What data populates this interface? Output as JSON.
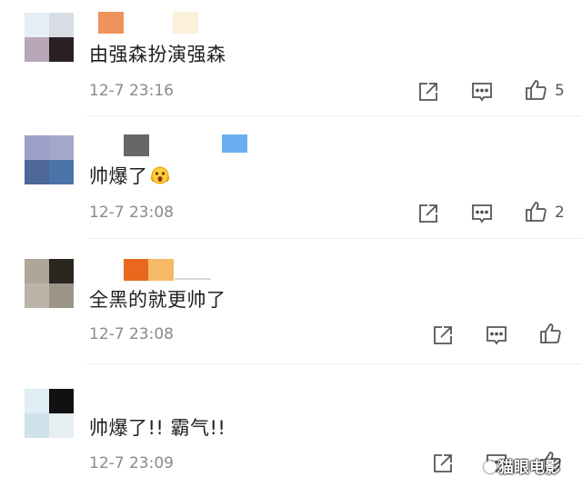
{
  "comments": [
    {
      "avatar_colors": [
        "#e4eef5",
        "#d8dde3",
        "#b9a6b8",
        "#2a1f24"
      ],
      "name_colors": [
        "#ef935a",
        "#fbf1d9"
      ],
      "text": "由强森扮演强森",
      "time": "12-7 23:16",
      "likes": "5"
    },
    {
      "avatar_colors": [
        "#9aa0c8",
        "#a4a7cb",
        "#4d6797",
        "#4d74a8"
      ],
      "name_colors": [
        "#676767",
        "#6ab0f0"
      ],
      "text": "帅爆了",
      "emoji": "surprised-face-emoji",
      "time": "12-7 23:08",
      "likes": "2"
    },
    {
      "avatar_colors": [
        "#aea696",
        "#2a251e",
        "#bab5a8",
        "#9c9689"
      ],
      "name_colors": [
        "#e8681d",
        "#f6b967"
      ],
      "text": "全黑的就更帅了",
      "time": "12-7 23:08",
      "likes": ""
    },
    {
      "avatar_colors": [
        "#dfeef4",
        "#111111",
        "#cfe1ea",
        "#e7eef2"
      ],
      "name_colors": [],
      "text": "帅爆了!! 霸气!!",
      "time": "12-7 23:09",
      "likes": ""
    }
  ],
  "watermark": "猫眼电影",
  "icons": {
    "share": "share-icon",
    "comment": "comment-icon",
    "like": "thumbs-up-icon"
  }
}
